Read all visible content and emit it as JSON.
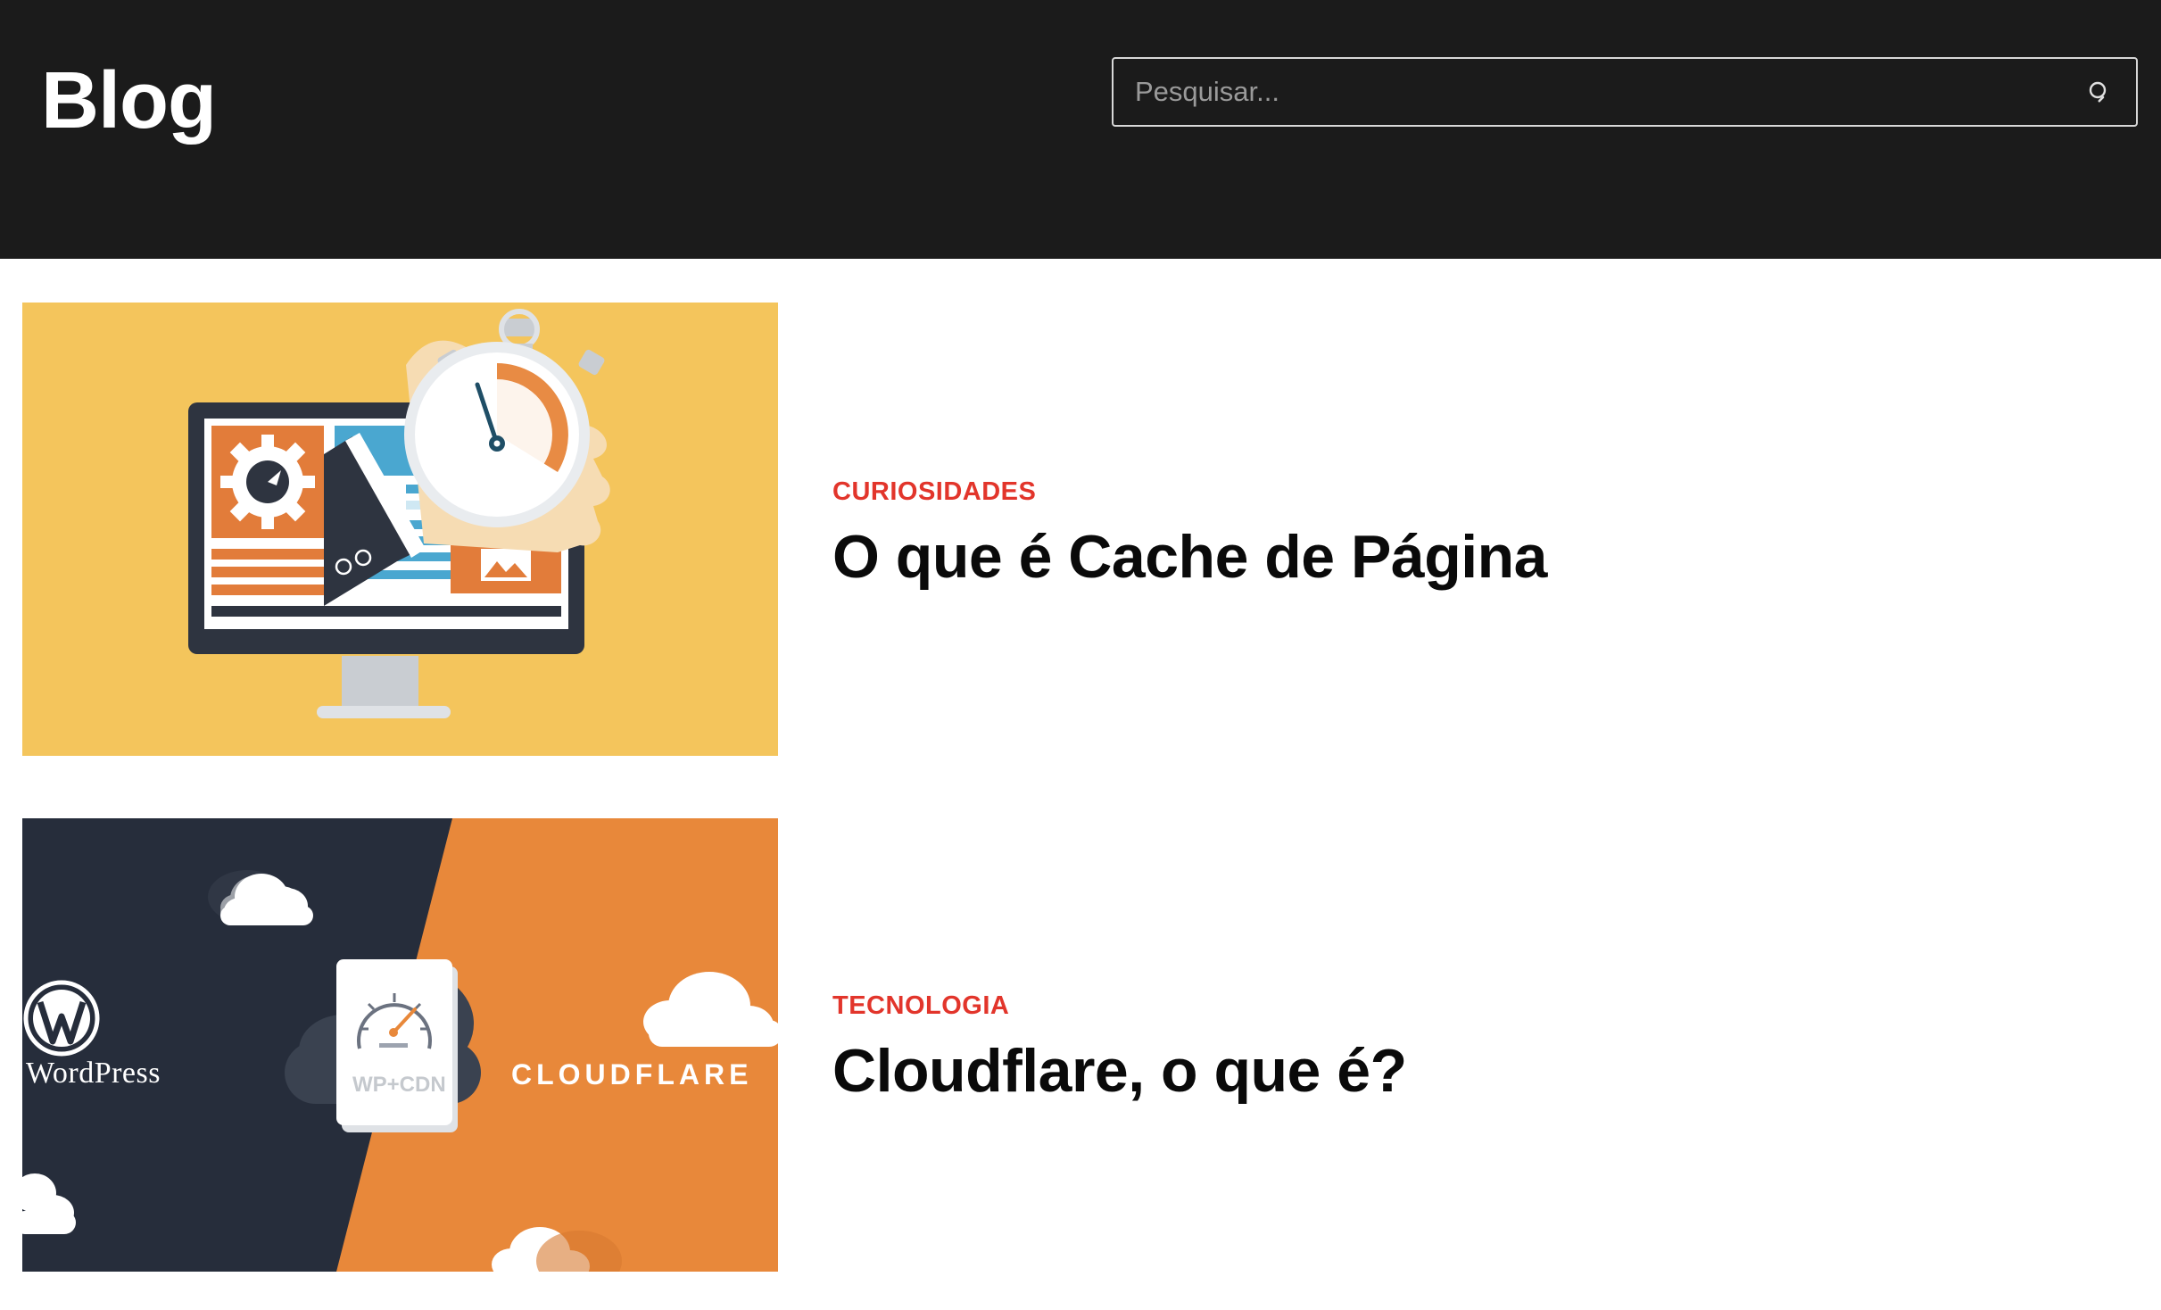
{
  "header": {
    "brand": "Blog",
    "search": {
      "placeholder": "Pesquisar...",
      "value": "",
      "icon": "search-icon"
    },
    "background": "#1b1b1b"
  },
  "posts": [
    {
      "category": "CURIOSIDADES",
      "title": "O que é Cache de Página",
      "image_bg": "#f4c55c"
    },
    {
      "category": "TECNOLOGIA",
      "title": "Cloudflare, o que é?",
      "image_text": {
        "left": "WordPress",
        "card": "WP+CDN",
        "right": "CLOUDFLARE"
      }
    }
  ],
  "colors": {
    "category": "#e2352b",
    "title": "#0a0a0a",
    "orange": "#e8883a",
    "navy": "#262d3b"
  }
}
